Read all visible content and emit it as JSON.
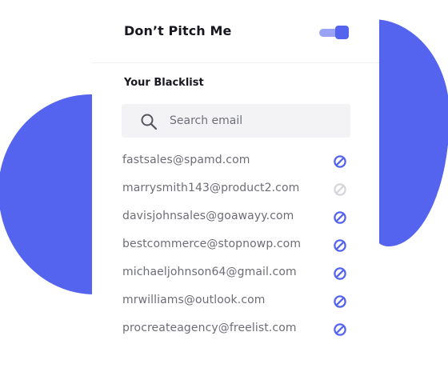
{
  "app": {
    "title": "Don’t Pitch Me",
    "toggle_on": true
  },
  "blacklist": {
    "heading": "Your Blacklist",
    "search": {
      "placeholder": "Search email",
      "value": ""
    },
    "items": [
      {
        "email": "fastsales@spamd.com",
        "blocked": true
      },
      {
        "email": "marrysmith143@product2.com",
        "blocked": false
      },
      {
        "email": "davisjohnsales@goawayy.com",
        "blocked": true
      },
      {
        "email": "bestcommerce@stopnowp.com",
        "blocked": true
      },
      {
        "email": "michaeljohnson64@gmail.com",
        "blocked": true
      },
      {
        "email": "mrwilliams@outlook.com",
        "blocked": true
      },
      {
        "email": "procreateagency@freelist.com",
        "blocked": true
      }
    ]
  },
  "icons": {
    "search": "search-icon",
    "block": "block-icon"
  },
  "colors": {
    "accent": "#5564EE",
    "accent_light": "#9aa2f5",
    "disabled": "#d6d6da",
    "text": "#6d6d76",
    "heading": "#17171f"
  }
}
